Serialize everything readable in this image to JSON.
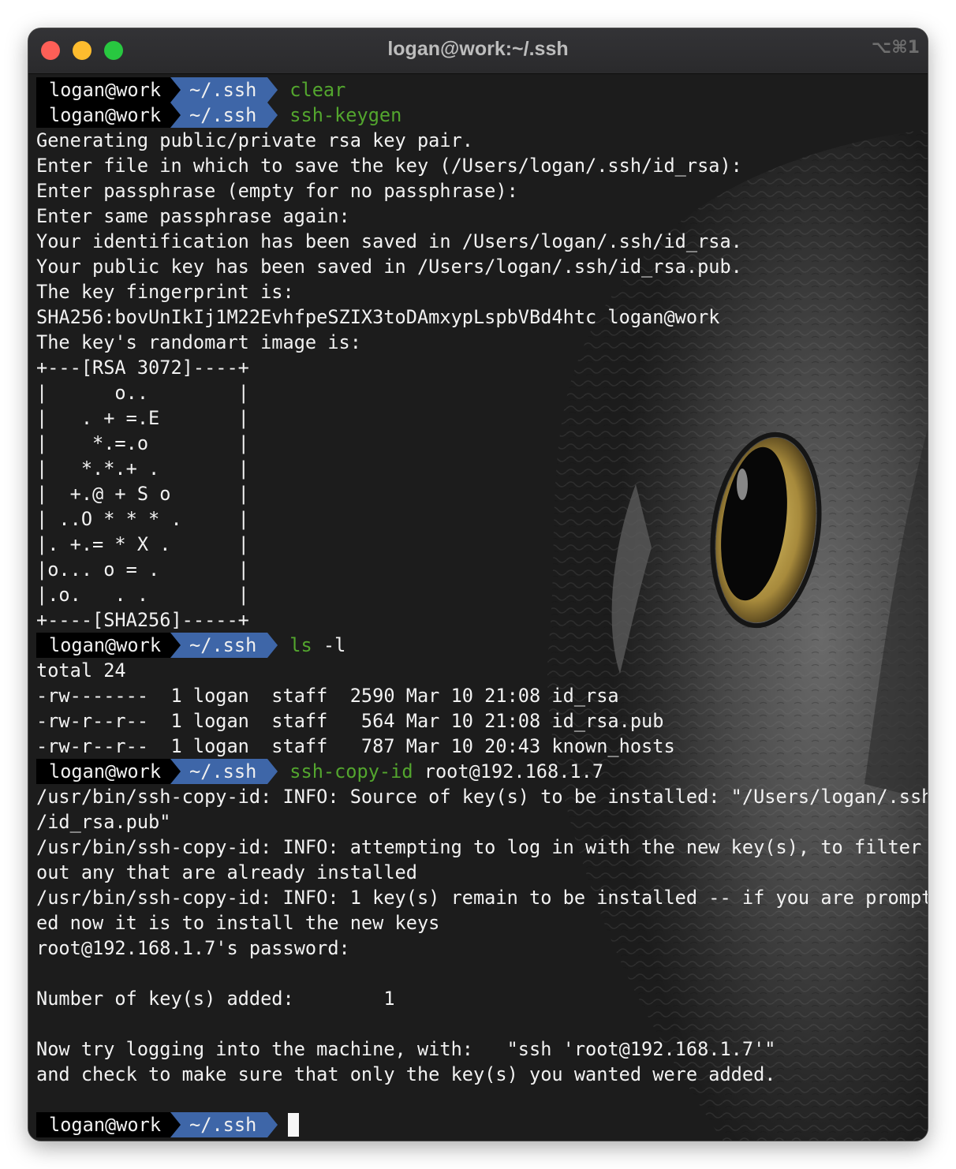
{
  "window": {
    "title": "logan@work:~/.ssh",
    "shortcut": "⌥⌘1"
  },
  "prompt": {
    "user": "logan@work",
    "dir": "~/.ssh"
  },
  "colors": {
    "prompt_user_bg": "#000000",
    "prompt_dir_bg": "#3e66a8",
    "command_green": "#53a62e",
    "terminal_bg": "#1c1c1c",
    "text": "#f2f2f2"
  },
  "lines": [
    {
      "type": "prompt",
      "cmd": "clear",
      "args": ""
    },
    {
      "type": "prompt",
      "cmd": "ssh-keygen",
      "args": ""
    },
    {
      "type": "text",
      "text": "Generating public/private rsa key pair."
    },
    {
      "type": "text",
      "text": "Enter file in which to save the key (/Users/logan/.ssh/id_rsa):"
    },
    {
      "type": "text",
      "text": "Enter passphrase (empty for no passphrase):"
    },
    {
      "type": "text",
      "text": "Enter same passphrase again:"
    },
    {
      "type": "text",
      "text": "Your identification has been saved in /Users/logan/.ssh/id_rsa."
    },
    {
      "type": "text",
      "text": "Your public key has been saved in /Users/logan/.ssh/id_rsa.pub."
    },
    {
      "type": "text",
      "text": "The key fingerprint is:"
    },
    {
      "type": "text",
      "text": "SHA256:bovUnIkIj1M22EvhfpeSZIX3toDAmxypLspbVBd4htc logan@work"
    },
    {
      "type": "text",
      "text": "The key's randomart image is:"
    },
    {
      "type": "text",
      "text": "+---[RSA 3072]----+"
    },
    {
      "type": "text",
      "text": "|      o..        |"
    },
    {
      "type": "text",
      "text": "|   . + =.E       |"
    },
    {
      "type": "text",
      "text": "|    *.=.o        |"
    },
    {
      "type": "text",
      "text": "|   *.*.+ .       |"
    },
    {
      "type": "text",
      "text": "|  +.@ + S o      |"
    },
    {
      "type": "text",
      "text": "| ..O * * * .     |"
    },
    {
      "type": "text",
      "text": "|. +.= * X .      |"
    },
    {
      "type": "text",
      "text": "|o... o = .       |"
    },
    {
      "type": "text",
      "text": "|.o.   . .        |"
    },
    {
      "type": "text",
      "text": "+----[SHA256]-----+"
    },
    {
      "type": "prompt",
      "cmd": "ls",
      "args": " -l"
    },
    {
      "type": "text",
      "text": "total 24"
    },
    {
      "type": "text",
      "text": "-rw-------  1 logan  staff  2590 Mar 10 21:08 id_rsa"
    },
    {
      "type": "text",
      "text": "-rw-r--r--  1 logan  staff   564 Mar 10 21:08 id_rsa.pub"
    },
    {
      "type": "text",
      "text": "-rw-r--r--  1 logan  staff   787 Mar 10 20:43 known_hosts"
    },
    {
      "type": "prompt",
      "cmd": "ssh-copy-id",
      "args": " root@192.168.1.7"
    },
    {
      "type": "text",
      "text": "/usr/bin/ssh-copy-id: INFO: Source of key(s) to be installed: \"/Users/logan/.ssh"
    },
    {
      "type": "text",
      "text": "/id_rsa.pub\""
    },
    {
      "type": "text",
      "text": "/usr/bin/ssh-copy-id: INFO: attempting to log in with the new key(s), to filter"
    },
    {
      "type": "text",
      "text": "out any that are already installed"
    },
    {
      "type": "text",
      "text": "/usr/bin/ssh-copy-id: INFO: 1 key(s) remain to be installed -- if you are prompt"
    },
    {
      "type": "text",
      "text": "ed now it is to install the new keys"
    },
    {
      "type": "text",
      "text": "root@192.168.1.7's password:"
    },
    {
      "type": "text",
      "text": ""
    },
    {
      "type": "text",
      "text": "Number of key(s) added:        1"
    },
    {
      "type": "text",
      "text": ""
    },
    {
      "type": "text",
      "text": "Now try logging into the machine, with:   \"ssh 'root@192.168.1.7'\""
    },
    {
      "type": "text",
      "text": "and check to make sure that only the key(s) you wanted were added."
    },
    {
      "type": "text",
      "text": ""
    },
    {
      "type": "prompt",
      "cmd": "",
      "args": "",
      "cursor": true
    }
  ]
}
